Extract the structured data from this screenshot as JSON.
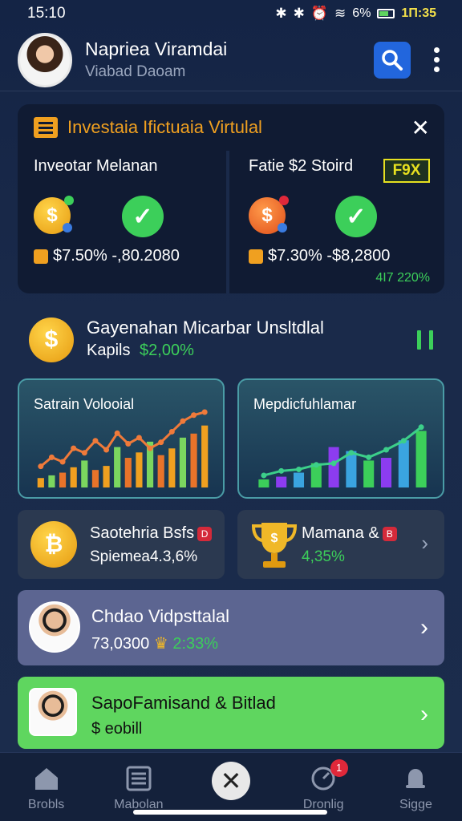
{
  "status_bar": {
    "time": "15:10",
    "battery": "6%",
    "time_right": "1Π:35"
  },
  "header": {
    "name": "Napriea Viramdai",
    "subtitle": "Viabad Daoam"
  },
  "invest_card": {
    "title": "Investaia Ifictuaia Virtulal",
    "left": {
      "label": "Inveotar Melanan",
      "value": "$7.50% -,80.2080"
    },
    "right": {
      "label": "Fatie $2 Stoird",
      "badge": "F9X",
      "value": "$7.30% -$8,2800",
      "pct": "4I7 220%"
    }
  },
  "promo": {
    "title": "Gayenahan Micarbar Unsltdlal",
    "sub_label": "Kapils",
    "sub_value": "$2,00%"
  },
  "charts": [
    {
      "title": "Satrain Volooial",
      "bars": [
        14,
        18,
        22,
        30,
        40,
        26,
        32,
        60,
        44,
        52,
        68,
        48,
        58,
        74,
        80,
        92
      ],
      "line": [
        28,
        40,
        34,
        52,
        46,
        62,
        50,
        72,
        58,
        66,
        52,
        60,
        74,
        88,
        96,
        100
      ],
      "colors": [
        "#f0a020",
        "#7bd65f"
      ]
    },
    {
      "title": "Mepdicfuhlamar",
      "bars": [
        12,
        16,
        22,
        36,
        60,
        54,
        40,
        44,
        70,
        84
      ],
      "line": [
        16,
        22,
        24,
        30,
        32,
        46,
        40,
        50,
        62,
        80
      ],
      "colors": [
        "#3ccf5a",
        "#8c3cf0"
      ]
    }
  ],
  "mid_cards": [
    {
      "title": "Saotehria Bsfs",
      "sub": "Spiemea4.3,6%"
    },
    {
      "title": "Mamana &",
      "sub": "4,35%"
    }
  ],
  "list_items": [
    {
      "title": "Chdao Vidpsttalal",
      "value": "73,0300",
      "pct": "2:33%"
    },
    {
      "title": "SapoFamisand & Bitlad",
      "sub": "$ eobill"
    }
  ],
  "nav": [
    {
      "label": "Brobls",
      "icon": "home-icon"
    },
    {
      "label": "Mabolan",
      "icon": "list-icon"
    },
    {
      "label": "Dronlig",
      "icon": "gauge-icon",
      "badge": "1"
    },
    {
      "label": "Sigge",
      "icon": "bell-icon"
    }
  ]
}
